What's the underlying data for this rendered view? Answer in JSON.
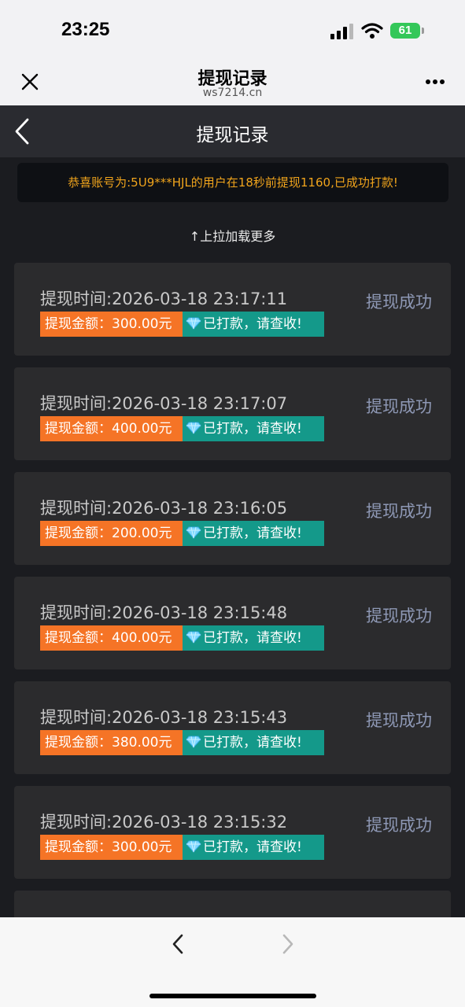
{
  "status_bar": {
    "time": "23:25",
    "battery": "61"
  },
  "browser": {
    "title": "提现记录",
    "url": "ws7214.cn"
  },
  "header": {
    "title": "提现记录"
  },
  "notice": {
    "text": "恭喜账号为:5U9***HJL的用户在18秒前提现1160,已成功打款!"
  },
  "load_more": "↑上拉加载更多",
  "records": [
    {
      "time": "提现时间:2026-03-18 23:17:11",
      "amount": "提现金额：300.00元",
      "paid": "已打款，请查收!",
      "status": "提现成功"
    },
    {
      "time": "提现时间:2026-03-18 23:17:07",
      "amount": "提现金额：400.00元",
      "paid": "已打款，请查收!",
      "status": "提现成功"
    },
    {
      "time": "提现时间:2026-03-18 23:16:05",
      "amount": "提现金额：200.00元",
      "paid": "已打款，请查收!",
      "status": "提现成功"
    },
    {
      "time": "提现时间:2026-03-18 23:15:48",
      "amount": "提现金额：400.00元",
      "paid": "已打款，请查收!",
      "status": "提现成功"
    },
    {
      "time": "提现时间:2026-03-18 23:15:43",
      "amount": "提现金额：380.00元",
      "paid": "已打款，请查收!",
      "status": "提现成功"
    },
    {
      "time": "提现时间:2026-03-18 23:15:32",
      "amount": "提现金额：300.00元",
      "paid": "已打款，请查收!",
      "status": "提现成功"
    }
  ],
  "colors": {
    "amount_bg": "#f57426",
    "paid_bg": "#14998a",
    "status_text": "#8e98b5",
    "notice_text": "#f0a41c"
  }
}
